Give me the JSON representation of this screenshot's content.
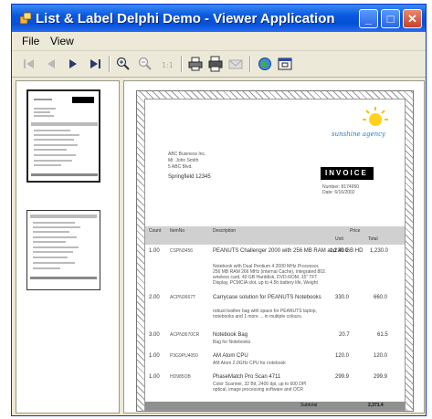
{
  "window": {
    "title": "List & Label Delphi Demo - Viewer Application",
    "buttons": {
      "minimize": "_",
      "maximize": "□",
      "close": "✕"
    }
  },
  "menu": [
    "File",
    "View"
  ],
  "toolbar": {
    "icons": [
      "first-page-icon",
      "previous-page-icon",
      "next-page-icon",
      "last-page-icon",
      "zoom-in-icon",
      "zoom-out-icon",
      "zoom-reset-icon",
      "print-icon",
      "print-all-icon",
      "send-icon",
      "web-icon",
      "exit-icon"
    ]
  },
  "document": {
    "logo": "sunshine agency",
    "address": [
      "ABC Business Inc.",
      "Mr. John Smith",
      "5 ABC Blvd.",
      "Springfield 12345"
    ],
    "invoice": {
      "label": "INVOICE",
      "number_label": "Number: 8174950",
      "date_label": "Date: 6/16/2002"
    },
    "table": {
      "headers": [
        "Count",
        "ItemNo",
        "Description",
        "Price",
        "Unit",
        "Total"
      ],
      "rows": [
        {
          "count": "1.00",
          "item": "CSPN3456",
          "desc": "PEANUTS Challenger 2000 with 256 MB RAM and 40 GB HD",
          "small": [
            "Notebook with Dual Pentium 4 2000 MHz Processor,",
            "256 MB RAM 266 MHz (internal Cache), integrated 802.",
            "wireless card, 40 GB Harddisk, DVD-ROM, 15\" TFT",
            "Display, PCMCIA slot, up to 4.5h battery life, Weight"
          ],
          "unit": "1,230.0",
          "total": "1,230.0"
        },
        {
          "count": "2.00",
          "item": "ACPN3667T",
          "desc": "Carrycase solution for PEANUTS Notebooks",
          "small": [
            "robust leather bag with space for PEANUTS laptop,",
            "notebooks and 1 more ... in multiple colours."
          ],
          "unit": "330.0",
          "total": "660.0"
        },
        {
          "count": "3.00",
          "item": "ACPN3670CR",
          "desc": "Notebook Bag",
          "small": [
            "Bag for Notebooks"
          ],
          "unit": "20.7",
          "total": "61.5"
        },
        {
          "count": "1.00",
          "item": "P3G9PU4050",
          "desc": "AM Atom CPU",
          "small": [
            "AM Atom 2.0GHz CPU for notebook"
          ],
          "unit": "120.0",
          "total": "120.0"
        },
        {
          "count": "1.00",
          "item": "HD985OB",
          "desc": "PhaseMatch Pro Scan 4711",
          "small": [
            "Color Scanner, 32 Bit, 2400 dpi, up to 600 DPI",
            "optical, image processing software and OCR"
          ],
          "unit": "299.9",
          "total": "299.9"
        }
      ],
      "subtotal_label": "Subtotal",
      "subtotal_value": "2,371.4"
    }
  }
}
